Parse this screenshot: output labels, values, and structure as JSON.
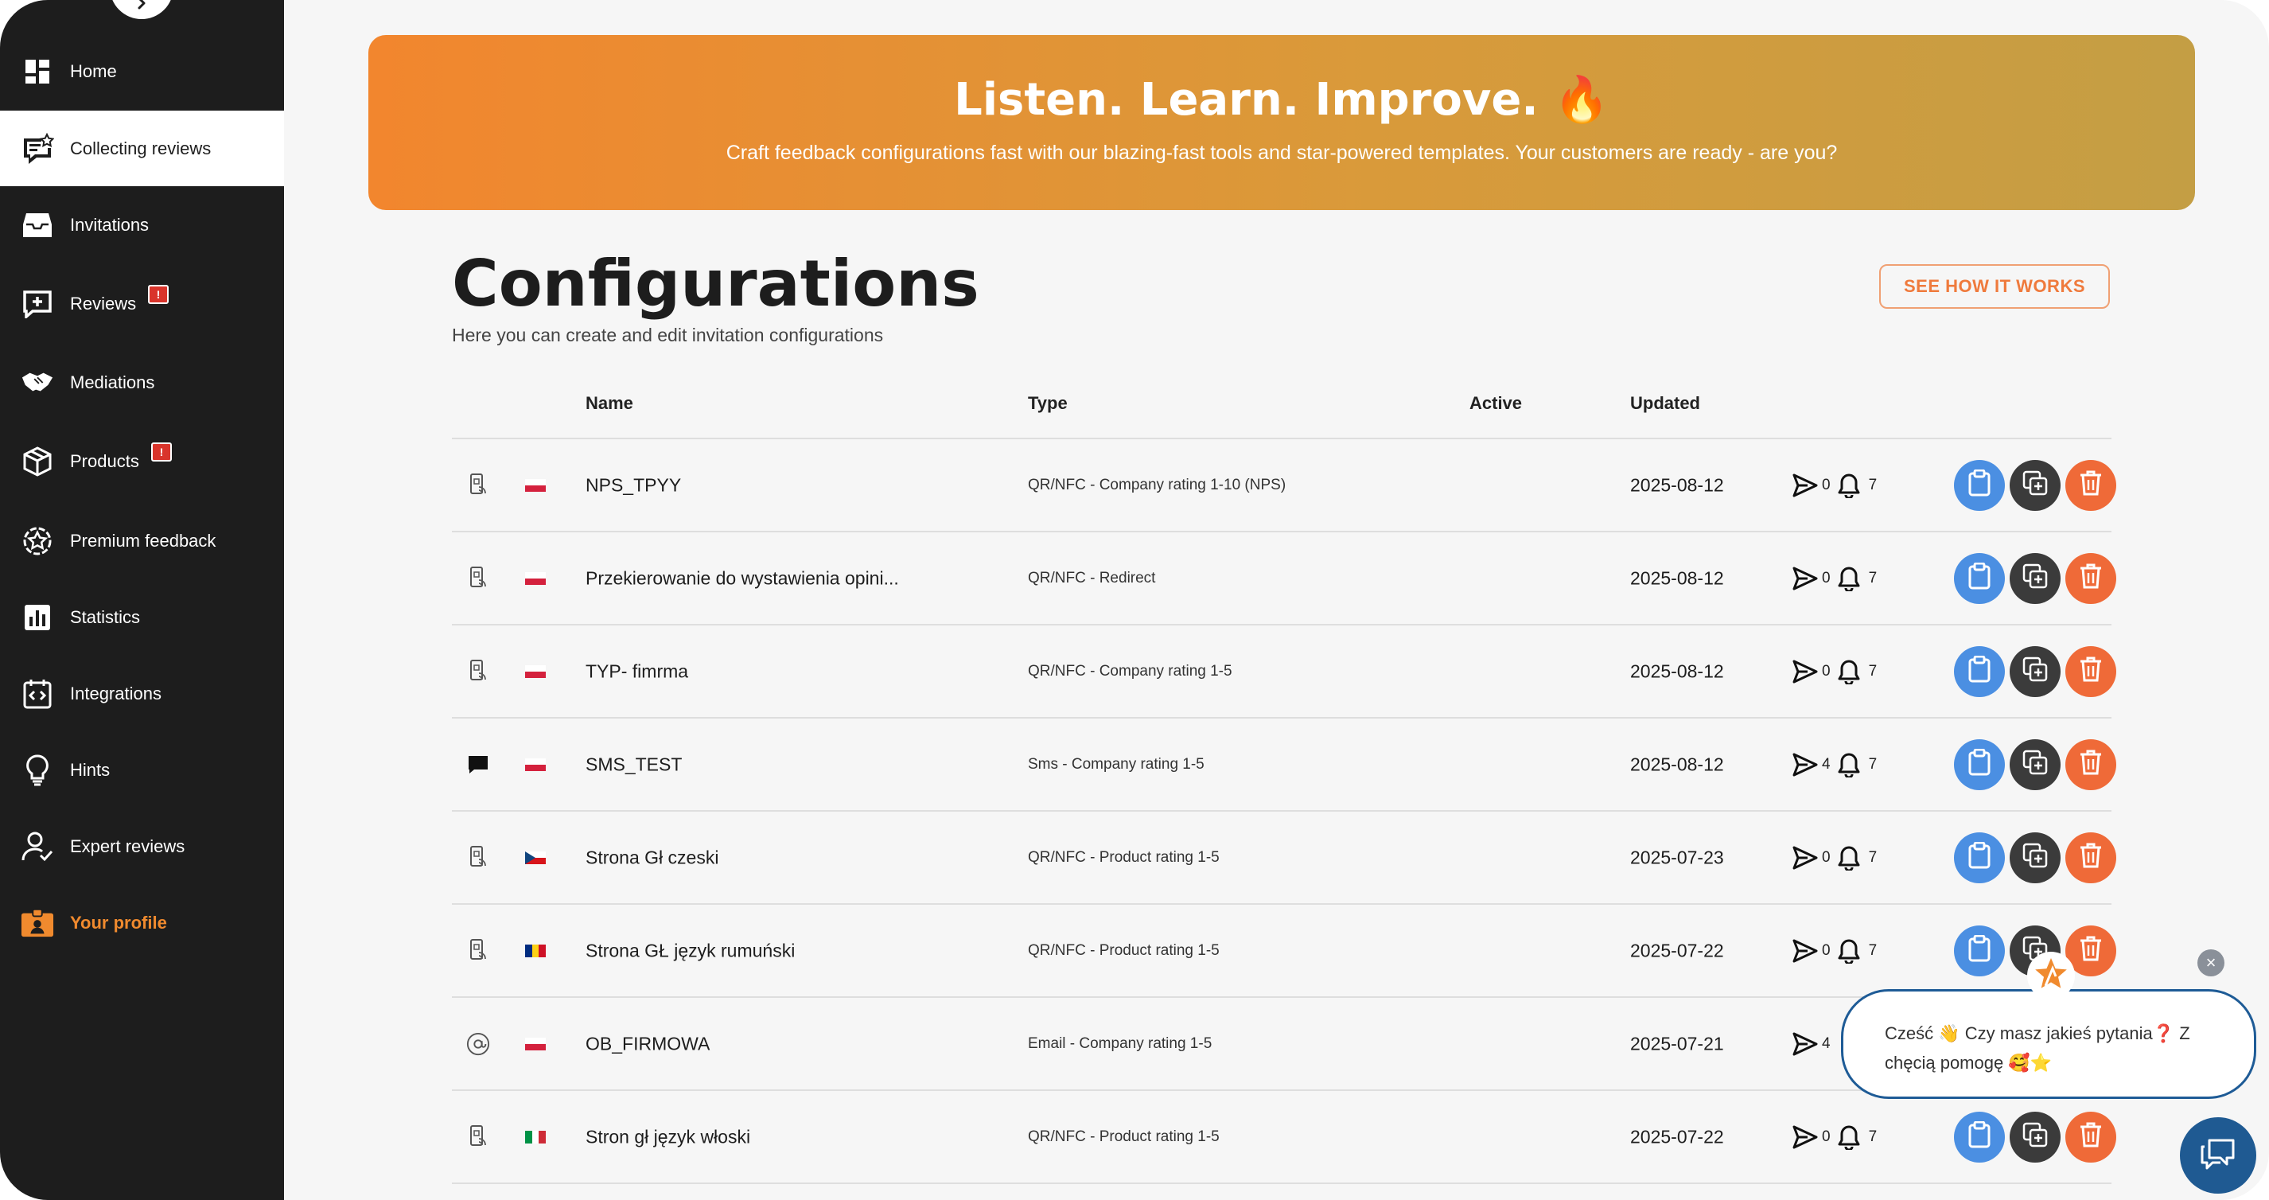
{
  "sidebar": {
    "items": [
      {
        "label": "Home",
        "icon": "grid-icon"
      },
      {
        "label": "Collecting reviews",
        "icon": "star-chat-icon"
      },
      {
        "label": "Invitations",
        "icon": "inbox-icon"
      },
      {
        "label": "Reviews",
        "icon": "plus-chat-icon",
        "badge": "!"
      },
      {
        "label": "Mediations",
        "icon": "handshake-icon"
      },
      {
        "label": "Products",
        "icon": "box-icon",
        "badge": "!"
      },
      {
        "label": "Premium feedback",
        "icon": "star-gear-icon"
      },
      {
        "label": "Statistics",
        "icon": "bar-chart-icon"
      },
      {
        "label": "Integrations",
        "icon": "code-icon"
      },
      {
        "label": "Hints",
        "icon": "lightbulb-icon"
      },
      {
        "label": "Expert reviews",
        "icon": "user-check-icon"
      },
      {
        "label": "Your profile",
        "icon": "id-card-icon"
      }
    ],
    "active": "Collecting reviews"
  },
  "banner": {
    "title": "Listen. Learn. Improve. 🔥",
    "subtitle": "Craft feedback configurations fast with our blazing-fast tools and star-powered templates. Your customers are ready - are you?"
  },
  "page": {
    "title": "Configurations",
    "subtitle": "Here you can create and edit invitation configurations",
    "see_how_label": "SEE HOW IT WORKS"
  },
  "table": {
    "headers": {
      "name": "Name",
      "type": "Type",
      "active": "Active",
      "updated": "Updated"
    },
    "rows": [
      {
        "channel": "qr-nfc-icon",
        "flag": "pl",
        "name": "NPS_TPYY",
        "type": "QR/NFC - Company rating 1-10 (NPS)",
        "updated": "2025-08-12",
        "sent": "0",
        "reminders": "7"
      },
      {
        "channel": "qr-nfc-icon",
        "flag": "pl",
        "name": "Przekierowanie do wystawienia opini...",
        "type": "QR/NFC - Redirect",
        "updated": "2025-08-12",
        "sent": "0",
        "reminders": "7"
      },
      {
        "channel": "qr-nfc-icon",
        "flag": "pl",
        "name": "TYP- fimrma",
        "type": "QR/NFC - Company rating 1-5",
        "updated": "2025-08-12",
        "sent": "0",
        "reminders": "7"
      },
      {
        "channel": "sms-icon",
        "flag": "pl",
        "name": "SMS_TEST",
        "type": "Sms - Company rating 1-5",
        "updated": "2025-08-12",
        "sent": "4",
        "reminders": "7"
      },
      {
        "channel": "qr-nfc-icon",
        "flag": "cz",
        "name": "Strona Gł czeski",
        "type": "QR/NFC - Product rating 1-5",
        "updated": "2025-07-23",
        "sent": "0",
        "reminders": "7"
      },
      {
        "channel": "qr-nfc-icon",
        "flag": "ro",
        "name": "Strona GŁ język rumuński",
        "type": "QR/NFC - Product rating 1-5",
        "updated": "2025-07-22",
        "sent": "0",
        "reminders": "7"
      },
      {
        "channel": "email-icon",
        "flag": "pl",
        "name": "OB_FIRMOWA",
        "type": "Email - Company rating 1-5",
        "updated": "2025-07-21",
        "sent": "4",
        "reminders": ""
      },
      {
        "channel": "qr-nfc-icon",
        "flag": "it",
        "name": "Stron gł język włoski",
        "type": "QR/NFC - Product rating 1-5",
        "updated": "2025-07-22",
        "sent": "0",
        "reminders": "7"
      }
    ]
  },
  "chat": {
    "message": "Cześć 👋 Czy masz jakieś pytania❓ Z chęcią pomogę 🥰⭐",
    "close_label": "×"
  },
  "colors": {
    "sidebar_bg": "#1d1d1d",
    "accent_orange": "#ef7a3c",
    "blue_button": "#4b8fe2",
    "dark_button": "#3b3b3b",
    "red_button": "#ef6a38",
    "badge_red": "#d9342b",
    "chat_blue": "#1e5b96"
  }
}
